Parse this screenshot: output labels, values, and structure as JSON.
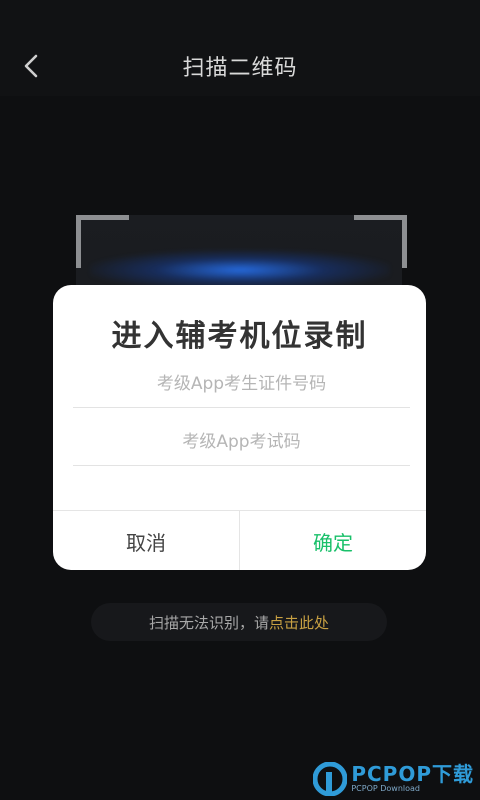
{
  "header": {
    "title": "扫描二维码"
  },
  "dialog": {
    "title": "进入辅考机位录制",
    "id_placeholder": "考级App考生证件号码",
    "code_placeholder": "考级App考试码",
    "cancel_label": "取消",
    "confirm_label": "确定"
  },
  "hint": {
    "text": "扫描无法识别，请",
    "link": "点击此处"
  },
  "watermark": {
    "name": "PCPOP下载",
    "sub": "PCPOP Download"
  },
  "colors": {
    "confirm": "#19c06a",
    "link": "#c8a143",
    "scan_glow": "#2878ff"
  }
}
